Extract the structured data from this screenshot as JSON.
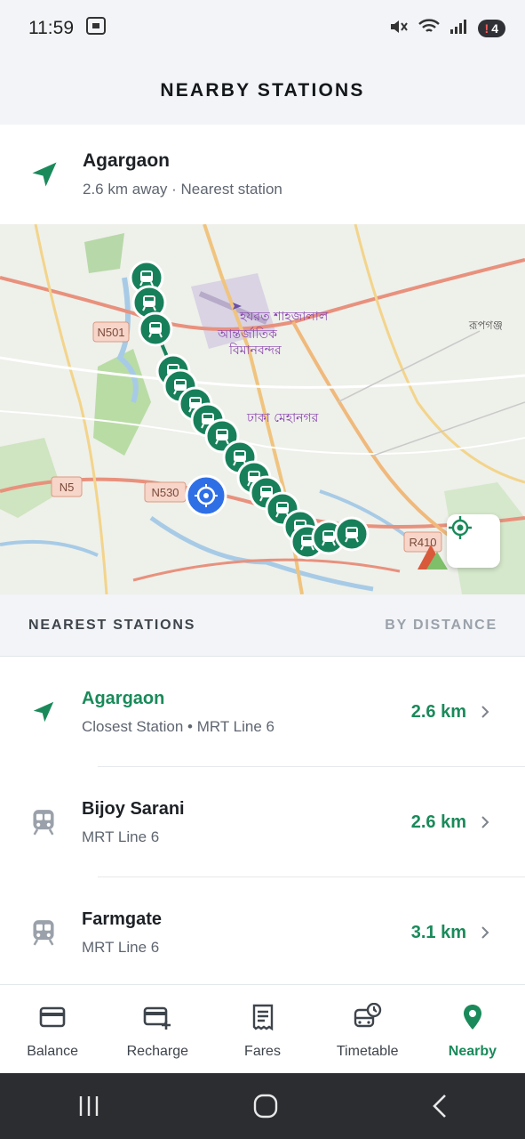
{
  "status_bar": {
    "time": "11:59",
    "notification_count": "4"
  },
  "header": {
    "title": "NEARBY STATIONS"
  },
  "summary": {
    "station": "Agargaon",
    "subtitle": "2.6 km away · Nearest station"
  },
  "map": {
    "labels": [
      "N501",
      "N5",
      "N530",
      "R410"
    ],
    "bangla_labels": [
      "হযরত শাহজালাল",
      "আন্তর্জাতিক",
      "বিমানবন্দর",
      "ঢাকা মেহানগর",
      "রূপগঞ্জ"
    ],
    "station_marker_count": 16
  },
  "list_header": {
    "title": "NEAREST STATIONS",
    "sort": "BY DISTANCE"
  },
  "stations": [
    {
      "name": "Agargaon",
      "meta": "Closest Station • MRT Line 6",
      "distance": "2.6 km",
      "icon": "navigation-arrow-icon"
    },
    {
      "name": "Bijoy Sarani",
      "meta": "MRT Line 6",
      "distance": "2.6 km",
      "icon": "train-icon"
    },
    {
      "name": "Farmgate",
      "meta": "MRT Line 6",
      "distance": "3.1 km",
      "icon": "train-icon"
    }
  ],
  "bottom_nav": [
    {
      "label": "Balance",
      "icon": "card-icon"
    },
    {
      "label": "Recharge",
      "icon": "card-plus-icon"
    },
    {
      "label": "Fares",
      "icon": "receipt-icon"
    },
    {
      "label": "Timetable",
      "icon": "bus-clock-icon"
    },
    {
      "label": "Nearby",
      "icon": "location-pin-icon",
      "active": true
    }
  ],
  "colors": {
    "accent": "#1a8a5a",
    "marker": "#17805a",
    "user_location": "#2f6fe6"
  }
}
